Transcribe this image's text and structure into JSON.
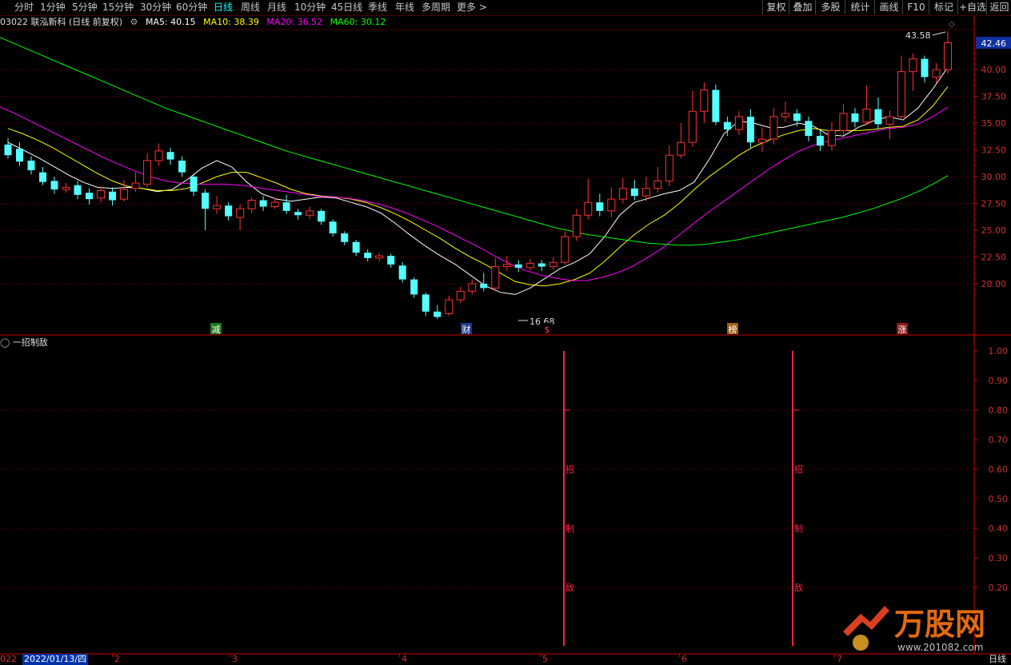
{
  "toolbar": {
    "tabs": [
      "分时",
      "1分钟",
      "5分钟",
      "15分钟",
      "30分钟",
      "60分钟",
      "日线",
      "周线",
      "月线",
      "10分钟",
      "45日线",
      "季线",
      "年线",
      "多周期",
      "更多 >"
    ],
    "active_tab": "日线",
    "right_buttons": [
      "复权",
      "叠加",
      "多股",
      "统计",
      "画线",
      "F10",
      "标记",
      "+自选",
      "返回"
    ]
  },
  "stock": {
    "code_name": "03022 联泓新科 (日线 前复权)",
    "ma5": "MA5: 40.15",
    "ma10": "MA10: 38.39",
    "ma20": "MA20: 36.52",
    "ma60": "MA60: 30.12",
    "last_price_tag": "42.46",
    "high_label": "43.58",
    "low_label": "16.68"
  },
  "colors": {
    "up": "#ff3232",
    "down": "#54ffff",
    "ma5": "#ffffff",
    "ma10": "#ffff00",
    "ma20": "#ff00ff",
    "ma60": "#00ff00",
    "axis": "#d00000",
    "grid": "#800000",
    "signal": "#ff2244"
  },
  "price_axis": [
    "40.00",
    "37.50",
    "35.00",
    "32.50",
    "30.00",
    "27.50",
    "25.00",
    "22.50",
    "20.00"
  ],
  "event_markers": [
    {
      "label": "减",
      "bg": "#1a7a1a",
      "fg": "#ffffff"
    },
    {
      "label": "财",
      "bg": "#1a3a8a",
      "fg": "#ffffff"
    },
    {
      "label": "$",
      "bg": "#000000",
      "fg": "#ff4040"
    },
    {
      "label": "榜",
      "bg": "#a06010",
      "fg": "#ffffff"
    },
    {
      "label": "涨",
      "bg": "#8a1a1a",
      "fg": "#ffffff"
    }
  ],
  "indicator": {
    "title": "一招制敌",
    "axis": [
      "1.00",
      "0.90",
      "0.80",
      "0.70",
      "0.60",
      "0.50",
      "0.40",
      "0.30",
      "0.20"
    ],
    "signal_text": [
      "一",
      "招",
      "制",
      "敌"
    ]
  },
  "bottom": {
    "left_cut": "022",
    "date": "2022/01/13/四",
    "month_ticks": [
      "2",
      "3",
      "4",
      "5",
      "6",
      "7"
    ],
    "period": "日线"
  },
  "watermark": {
    "brand": "万股网",
    "url": "www.201082.com"
  },
  "chart_data": [
    {
      "type": "candlestick",
      "title": "03022 联泓新科 (日线 前复权)",
      "ylim": [
        17.0,
        44.0
      ],
      "series": [
        {
          "name": "MA5",
          "values": [
            33.2,
            32.5,
            31.8,
            31.0,
            30.2,
            29.5,
            29.0,
            28.9,
            29.0,
            28.9,
            28.6,
            28.8,
            29.7,
            30.8,
            31.5,
            30.9,
            29.5,
            28.4,
            27.9,
            27.7,
            27.9,
            28.1,
            28.0,
            27.6,
            27.2,
            26.6,
            25.6,
            24.5,
            23.5,
            22.6,
            21.8,
            20.8,
            19.8,
            19.2,
            19.0,
            19.6,
            20.5,
            21.4,
            22.0,
            22.8,
            24.4,
            26.4,
            27.6,
            28.0,
            28.4,
            28.7,
            29.5,
            31.6,
            34.0,
            35.2,
            35.0,
            34.6,
            34.6,
            35.0,
            34.7,
            33.9,
            33.8,
            34.6,
            35.2,
            35.6,
            35.3,
            36.4,
            38.2,
            40.2
          ]
        },
        {
          "name": "MA10",
          "values": [
            34.5,
            34.0,
            33.4,
            32.7,
            31.9,
            31.1,
            30.3,
            29.6,
            29.1,
            28.9,
            28.7,
            28.7,
            28.9,
            29.4,
            30.0,
            30.4,
            30.4,
            29.9,
            29.4,
            28.8,
            28.4,
            28.2,
            28.1,
            27.9,
            27.6,
            27.1,
            26.5,
            25.8,
            25.0,
            24.2,
            23.3,
            22.5,
            21.8,
            21.0,
            20.2,
            19.9,
            19.8,
            20.0,
            20.4,
            21.0,
            22.1,
            23.4,
            24.6,
            25.6,
            26.4,
            27.5,
            28.8,
            30.0,
            31.0,
            32.0,
            32.8,
            33.4,
            33.9,
            34.3,
            34.5,
            34.3,
            34.3,
            34.3,
            34.4,
            34.6,
            34.7,
            35.3,
            36.6,
            38.4
          ]
        },
        {
          "name": "MA20",
          "values": [
            36.5,
            35.9,
            35.2,
            34.5,
            33.8,
            33.1,
            32.4,
            31.7,
            31.1,
            30.5,
            30.0,
            29.6,
            29.4,
            29.3,
            29.3,
            29.3,
            29.2,
            29.0,
            28.8,
            28.6,
            28.4,
            28.2,
            28.1,
            28.0,
            27.8,
            27.5,
            27.1,
            26.6,
            26.0,
            25.4,
            24.7,
            24.0,
            23.3,
            22.5,
            21.8,
            21.2,
            20.8,
            20.5,
            20.3,
            20.3,
            20.6,
            21.0,
            21.6,
            22.4,
            23.3,
            24.4,
            25.5,
            26.6,
            27.6,
            28.6,
            29.6,
            30.6,
            31.5,
            32.3,
            32.9,
            33.3,
            33.6,
            33.9,
            34.2,
            34.5,
            34.6,
            34.9,
            35.6,
            36.5
          ]
        },
        {
          "name": "MA60",
          "values": [
            43.0,
            42.4,
            41.8,
            41.2,
            40.6,
            40.0,
            39.4,
            38.8,
            38.2,
            37.6,
            37.0,
            36.4,
            35.9,
            35.4,
            34.9,
            34.4,
            33.9,
            33.4,
            32.9,
            32.4,
            32.0,
            31.6,
            31.2,
            30.8,
            30.4,
            30.0,
            29.6,
            29.2,
            28.8,
            28.4,
            28.0,
            27.6,
            27.2,
            26.8,
            26.4,
            26.0,
            25.6,
            25.2,
            24.9,
            24.6,
            24.4,
            24.2,
            24.0,
            23.8,
            23.7,
            23.6,
            23.6,
            23.7,
            23.9,
            24.1,
            24.4,
            24.7,
            25.0,
            25.3,
            25.6,
            25.9,
            26.2,
            26.6,
            27.0,
            27.5,
            28.0,
            28.6,
            29.3,
            30.1
          ]
        }
      ],
      "candles": [
        [
          33.0,
          32.0,
          33.6,
          31.7
        ],
        [
          32.6,
          31.4,
          33.2,
          31.0
        ],
        [
          31.5,
          30.6,
          31.9,
          30.2
        ],
        [
          30.4,
          29.5,
          30.9,
          29.2
        ],
        [
          29.6,
          28.8,
          30.0,
          28.4
        ],
        [
          28.8,
          29.0,
          29.4,
          28.5
        ],
        [
          29.2,
          28.3,
          29.6,
          27.9
        ],
        [
          28.5,
          27.9,
          28.9,
          27.4
        ],
        [
          28.0,
          28.7,
          29.1,
          27.6
        ],
        [
          28.6,
          27.8,
          29.0,
          27.3
        ],
        [
          27.9,
          28.8,
          29.7,
          27.7
        ],
        [
          28.9,
          29.4,
          30.4,
          28.6
        ],
        [
          29.3,
          31.5,
          32.2,
          29.0
        ],
        [
          31.5,
          32.4,
          33.1,
          31.0
        ],
        [
          32.3,
          31.6,
          32.7,
          31.1
        ],
        [
          31.5,
          30.4,
          31.9,
          30.0
        ],
        [
          30.0,
          28.6,
          30.3,
          28.2
        ],
        [
          28.5,
          27.0,
          28.8,
          25.0
        ],
        [
          27.0,
          27.3,
          28.2,
          26.5
        ],
        [
          27.3,
          26.3,
          27.6,
          25.9
        ],
        [
          26.2,
          27.0,
          27.4,
          25.0
        ],
        [
          27.0,
          27.8,
          28.1,
          26.6
        ],
        [
          27.8,
          27.2,
          28.2,
          26.8
        ],
        [
          27.2,
          27.6,
          28.0,
          27.0
        ],
        [
          27.6,
          26.8,
          28.3,
          26.5
        ],
        [
          26.7,
          26.4,
          27.0,
          26.0
        ],
        [
          26.4,
          26.8,
          27.2,
          26.0
        ],
        [
          26.8,
          25.8,
          27.0,
          25.5
        ],
        [
          25.8,
          24.7,
          26.0,
          24.4
        ],
        [
          24.7,
          23.9,
          24.9,
          23.6
        ],
        [
          23.9,
          22.9,
          24.1,
          22.6
        ],
        [
          22.9,
          22.4,
          23.2,
          22.1
        ],
        [
          22.4,
          22.6,
          22.9,
          22.1
        ],
        [
          22.6,
          21.8,
          22.8,
          21.5
        ],
        [
          21.7,
          20.4,
          22.0,
          20.1
        ],
        [
          20.4,
          19.0,
          20.6,
          18.7
        ],
        [
          19.0,
          17.4,
          19.2,
          17.0
        ],
        [
          17.4,
          16.9,
          18.0,
          16.7
        ],
        [
          17.2,
          18.5,
          18.9,
          17.0
        ],
        [
          18.5,
          19.3,
          19.7,
          18.2
        ]
      ],
      "candles_right": [
        [
          19.3,
          20.0,
          20.4,
          19.0
        ],
        [
          20.0,
          19.6,
          21.0,
          19.3
        ],
        [
          19.6,
          21.6,
          22.4,
          19.3
        ],
        [
          21.6,
          21.8,
          22.6,
          21.2
        ],
        [
          21.8,
          21.5,
          22.2,
          21.1
        ],
        [
          21.5,
          21.9,
          22.3,
          21.2
        ],
        [
          21.9,
          21.6,
          22.2,
          21.2
        ],
        [
          21.6,
          22.0,
          22.5,
          21.3
        ],
        [
          22.0,
          24.4,
          24.9,
          21.8
        ],
        [
          24.4,
          26.4,
          27.0,
          24.0
        ],
        [
          26.4,
          27.6,
          29.8,
          26.0
        ],
        [
          27.6,
          26.8,
          28.4,
          26.3
        ],
        [
          26.8,
          27.9,
          29.0,
          26.2
        ],
        [
          27.9,
          28.9,
          29.9,
          27.5
        ],
        [
          28.9,
          28.2,
          29.7,
          27.8
        ],
        [
          28.2,
          28.9,
          30.0,
          27.7
        ],
        [
          28.9,
          29.6,
          30.9,
          28.5
        ],
        [
          29.6,
          32.0,
          32.9,
          29.1
        ],
        [
          32.0,
          33.2,
          35.0,
          31.7
        ],
        [
          33.2,
          36.1,
          38.0,
          32.8
        ],
        [
          36.1,
          38.1,
          38.8,
          35.0
        ],
        [
          38.1,
          35.1,
          38.6,
          34.8
        ],
        [
          35.1,
          34.4,
          35.6,
          33.8
        ],
        [
          34.4,
          35.6,
          36.1,
          33.9
        ],
        [
          35.6,
          33.2,
          36.3,
          32.7
        ],
        [
          33.2,
          33.5,
          34.6,
          32.3
        ],
        [
          33.5,
          35.6,
          36.4,
          33.0
        ],
        [
          35.6,
          35.9,
          37.0,
          35.1
        ],
        [
          35.9,
          35.2,
          36.3,
          34.7
        ],
        [
          35.2,
          33.8,
          35.6,
          33.3
        ],
        [
          33.8,
          32.9,
          34.3,
          32.4
        ],
        [
          32.9,
          34.3,
          35.1,
          32.4
        ],
        [
          34.3,
          35.9,
          36.8,
          33.9
        ],
        [
          35.9,
          35.1,
          36.4,
          34.6
        ],
        [
          35.1,
          36.3,
          38.5,
          34.8
        ],
        [
          36.3,
          34.9,
          37.4,
          34.4
        ],
        [
          34.9,
          35.6,
          36.2,
          33.5
        ],
        [
          35.6,
          39.8,
          41.3,
          35.3
        ],
        [
          39.8,
          41.0,
          41.5,
          38.0
        ],
        [
          41.0,
          39.3,
          41.3,
          38.8
        ],
        [
          39.3,
          40.0,
          40.6,
          38.7
        ],
        [
          40.0,
          42.5,
          43.6,
          39.6
        ]
      ]
    },
    {
      "type": "bar",
      "title": "一招制敌",
      "ylim": [
        0.1,
        1.05
      ],
      "signals": [
        1,
        1
      ],
      "values": [
        1.0,
        1.0
      ]
    }
  ]
}
